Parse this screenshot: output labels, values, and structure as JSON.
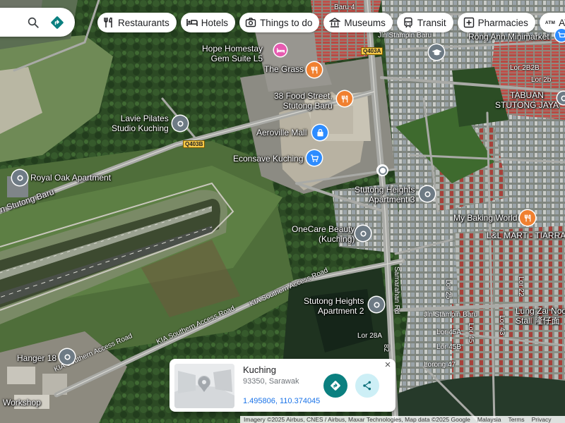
{
  "toolbar": {
    "search_icon": "search-icon",
    "directions_icon": "directions-icon"
  },
  "chips": [
    {
      "label": "Restaurants",
      "icon": "restaurant-icon"
    },
    {
      "label": "Hotels",
      "icon": "hotel-icon"
    },
    {
      "label": "Things to do",
      "icon": "camera-icon"
    },
    {
      "label": "Museums",
      "icon": "museum-icon"
    },
    {
      "label": "Transit",
      "icon": "transit-icon"
    },
    {
      "label": "Pharmacies",
      "icon": "pharmacy-icon"
    },
    {
      "label": "ATMs",
      "icon": "atm-icon",
      "mark": "ATM"
    }
  ],
  "places": {
    "hope_homestay": "Hope Homestay\nGem Suite L5",
    "the_grass": "The Grass",
    "food_street": "38 Food Street,\nStutong Baru",
    "lavie": "Lavie Pilates\nStudio Kuching",
    "aeroville": "Aeroville Mall",
    "econsave": "Econsave Kuching",
    "royal_oak": "Royal Oak Apartment",
    "stutong_heights_3": "Stutong Heights\nApartment 3",
    "onecare": "OneCare Beauty\n(Kuching)",
    "stutong_heights_2": "Stutong Heights\nApartment 2",
    "hanger18": "Hanger 18",
    "workshop": "Workshop",
    "my_baking": "My Baking World",
    "ll_mart": "L&L MART - TIARRA",
    "rong_ann": "Rong Ann Minimarket",
    "tabuan": "TABUAN\nSTUTONG JAYA",
    "lung_zai": "Lung Zai Noo\nStall 隆仔面",
    "stutong_baru_left": "n Stutong Baru"
  },
  "streets": {
    "jln_stampin_baru_top": "Jln Stampin Baru",
    "baru4": "Baru 4",
    "lor2b2b": "Lor 2B2B",
    "lor2b": "Lor 2b",
    "kia1": "KIA Southern Access Road",
    "kia2": "KIA Southern Access Road",
    "kia3": "KIA Southern Access Road",
    "samarahan": "Samarahan Rd",
    "jln_stampin_baru_bottom": "Jln Stampin Baru",
    "lor28a": "Lor 28A",
    "lor45a": "Lor 45A",
    "lor45b": "Lor 45B",
    "lor45": "Lor 45",
    "lor43": "Lor 43",
    "lor22": "Lor 22",
    "lor25": "Lor 25",
    "lor47": "Lorong 47",
    "r82": "82"
  },
  "road_shields": {
    "q403a": "Q403A",
    "q403b": "Q403B"
  },
  "card": {
    "title": "Kuching",
    "address": "93350, Sarawak",
    "coordinates": "1.495806, 110.374045",
    "close": "×"
  },
  "footer": {
    "imagery": "Imagery ©2025 Airbus, CNES / Airbus, Maxar Technologies, Map data ©2025 Google",
    "country": "Malaysia",
    "terms": "Terms",
    "privacy": "Privacy"
  },
  "colors": {
    "pin_grey": "#6e7b85",
    "pin_orange": "#f08030",
    "pin_blue": "#2d8cff",
    "pin_pink": "#e65bb0",
    "directions_teal": "#0b8080"
  }
}
